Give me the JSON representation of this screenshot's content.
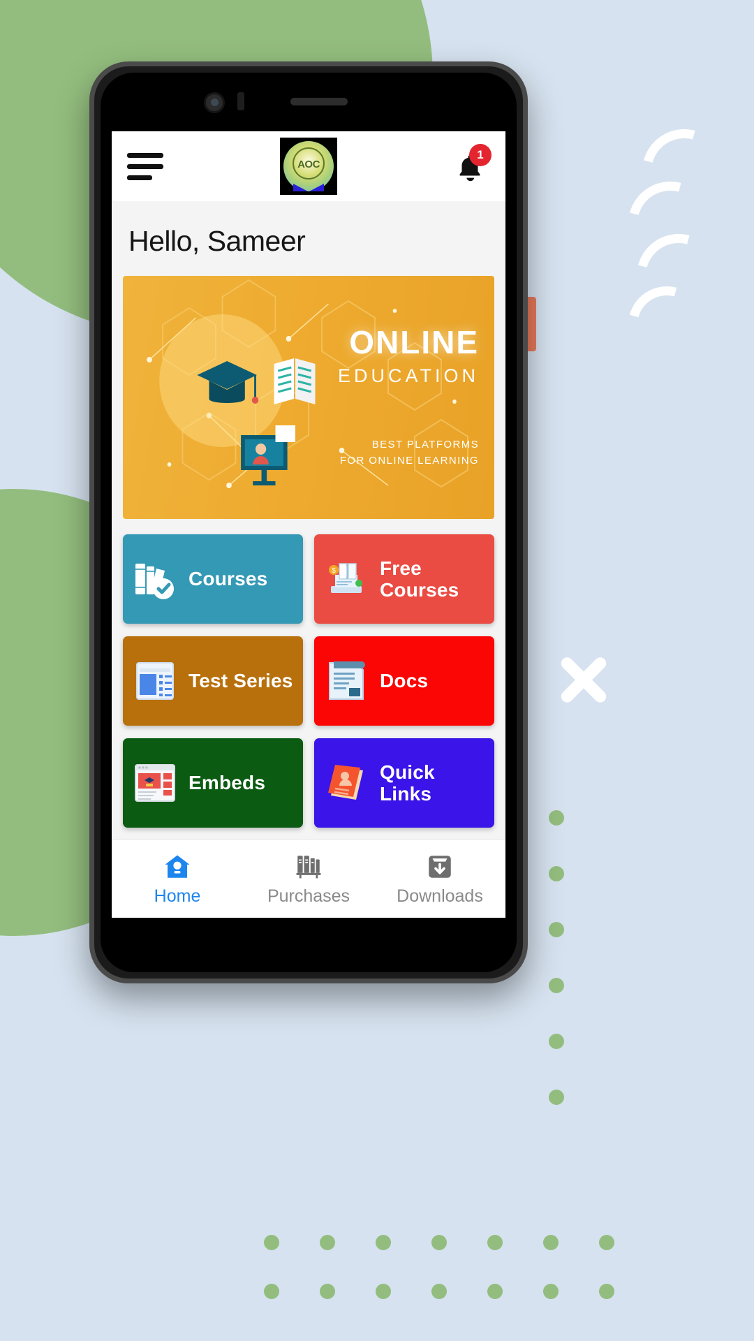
{
  "background": {
    "green": "#93bd7e",
    "blue": "#d6e2ef",
    "white": "#ffffff",
    "accent_button": "#e8795c"
  },
  "appbar": {
    "menu_icon": "hamburger-menu-icon",
    "logo_text": "AOC",
    "logo_alt": "aoc-logo",
    "notification_icon": "bell-icon",
    "notification_count": "1",
    "badge_color": "#e3252f"
  },
  "greeting": {
    "text": "Hello, Sameer"
  },
  "banner": {
    "title": "ONLINE",
    "subtitle": "EDUCATION",
    "footer_line1": "BEST PLATFORMS",
    "footer_line2": "FOR ONLINE LEARNING",
    "bg_color": "#eeab2f"
  },
  "cards": [
    {
      "label": "Courses",
      "color": "#3499b5",
      "icon": "books-check-icon"
    },
    {
      "label": "Free Courses",
      "color": "#ea4b43",
      "icon": "laptop-book-icon"
    },
    {
      "label": "Test Series",
      "color": "#b8700c",
      "icon": "test-paper-icon"
    },
    {
      "label": "Docs",
      "color": "#fb0505",
      "icon": "document-icon"
    },
    {
      "label": "Embeds",
      "color": "#0b5b12",
      "icon": "embed-window-icon"
    },
    {
      "label": "Quick Links",
      "color": "#3a14e8",
      "icon": "address-book-icon"
    }
  ],
  "navbar": {
    "active_color": "#1d86ee",
    "inactive_color": "#8a8a8a",
    "items": [
      {
        "label": "Home",
        "icon": "home-icon",
        "active": true
      },
      {
        "label": "Purchases",
        "icon": "bookshelf-icon",
        "active": false
      },
      {
        "label": "Downloads",
        "icon": "download-box-icon",
        "active": false
      }
    ]
  }
}
